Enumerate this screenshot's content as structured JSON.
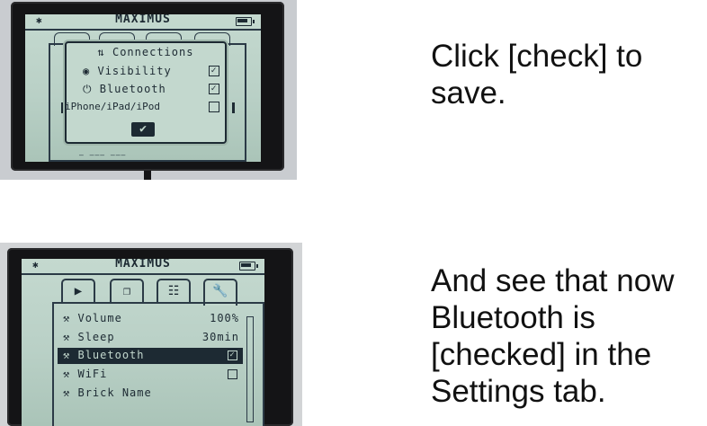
{
  "steps": [
    {
      "device": {
        "title": "MAXIMUS",
        "dialog": {
          "header": "Connections",
          "header_icon": "connections-icon",
          "rows": [
            {
              "icon": "◉",
              "label": "Visibility",
              "checked": true
            },
            {
              "icon": "⏻",
              "label": "Bluetooth",
              "checked": true
            },
            {
              "icon": "",
              "label": "iPhone/iPad/iPod",
              "checked": false
            }
          ],
          "ok_glyph": "✔"
        }
      },
      "caption": "Click [check] to\nsave."
    },
    {
      "device": {
        "title": "MAXIMUS",
        "tabs": [
          {
            "icon": "▶",
            "name": "run"
          },
          {
            "icon": "❐",
            "name": "files"
          },
          {
            "icon": "☷",
            "name": "apps"
          },
          {
            "icon": "🔧",
            "name": "settings"
          }
        ],
        "settings": [
          {
            "label": "Volume",
            "value": "100%"
          },
          {
            "label": "Sleep",
            "value": "30min"
          },
          {
            "label": "Bluetooth",
            "checked": true
          },
          {
            "label": "WiFi",
            "checked": false
          },
          {
            "label": "Brick Name"
          }
        ]
      },
      "caption": "And see that now\nBluetooth is\n[checked] in the\nSettings tab."
    }
  ],
  "colors": {
    "lcd": "#bcd3c9",
    "ink": "#1d2a33",
    "bezel": "#141416"
  }
}
